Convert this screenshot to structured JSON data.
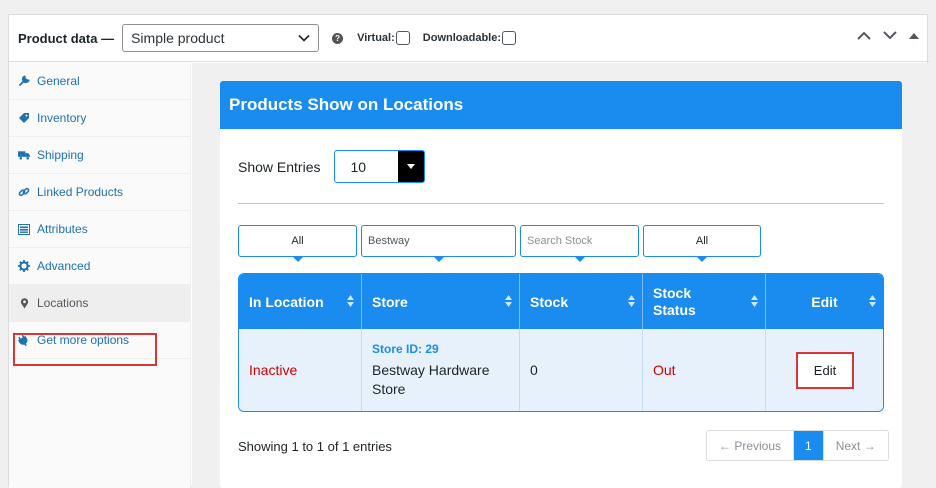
{
  "header": {
    "label": "Product data —",
    "product_type": "Simple product",
    "help": "?",
    "virtual_label": "Virtual:",
    "downloadable_label": "Downloadable:"
  },
  "sidebar": {
    "items": [
      {
        "label": "General",
        "icon": "wrench-icon"
      },
      {
        "label": "Inventory",
        "icon": "tag-icon"
      },
      {
        "label": "Shipping",
        "icon": "truck-icon"
      },
      {
        "label": "Linked Products",
        "icon": "link-icon"
      },
      {
        "label": "Attributes",
        "icon": "list-icon"
      },
      {
        "label": "Advanced",
        "icon": "gear-icon"
      },
      {
        "label": "Locations",
        "icon": "pin-icon",
        "active": true
      },
      {
        "label": "Get more options",
        "icon": "plugin-icon"
      }
    ]
  },
  "panel": {
    "title": "Products Show on Locations",
    "show_entries_label": "Show Entries",
    "entries_value": "10",
    "filters": {
      "in_location": "All",
      "store": "Bestway",
      "stock_placeholder": "Search Stock",
      "stock_status": "All"
    },
    "columns": [
      "In Location",
      "Store",
      "Stock",
      "Stock Status",
      "Edit"
    ],
    "rows": [
      {
        "in_location": "Inactive",
        "store_id": "Store ID: 29",
        "store_name": "Bestway Hardware Store",
        "stock": "0",
        "stock_status": "Out",
        "edit": "Edit"
      }
    ],
    "showing": "Showing 1 to 1 of 1 entries",
    "pagination": {
      "previous": "← Previous",
      "current": "1",
      "next": "Next →"
    }
  },
  "colors": {
    "accent": "#1a8cf0",
    "highlight": "#d63638",
    "inactive": "#d00000"
  }
}
